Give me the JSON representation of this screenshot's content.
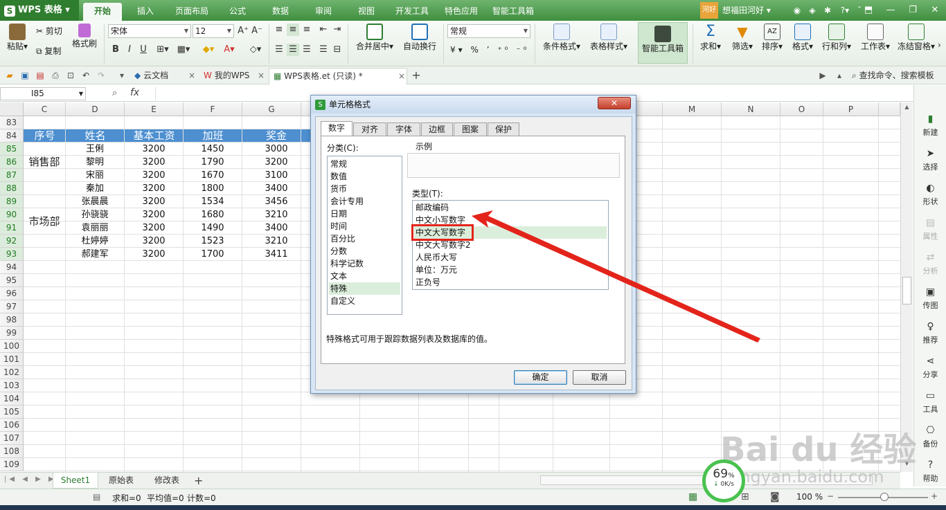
{
  "app": {
    "logo": "WPS 表格"
  },
  "menu": {
    "tabs": [
      "开始",
      "插入",
      "页面布局",
      "公式",
      "数据",
      "审阅",
      "视图",
      "开发工具",
      "特色应用",
      "智能工具箱"
    ],
    "active": "开始",
    "user_badge": "河好",
    "user_name": "想福田河好"
  },
  "ribbon": {
    "paste": "粘贴",
    "cut": "剪切",
    "copy": "复制",
    "format_painter": "格式刷",
    "font_name": "宋体",
    "font_size": "12",
    "bold": "B",
    "italic": "I",
    "underline": "U",
    "merge_center": "合并居中",
    "wrap_text": "自动换行",
    "number_format": "常规",
    "cond_format": "条件格式",
    "table_style": "表格样式",
    "smart_toolbox": "智能工具箱",
    "sum": "求和",
    "filter": "筛选",
    "sort": "排序",
    "format": "格式",
    "row_col": "行和列",
    "worksheet": "工作表",
    "freeze": "冻结窗格",
    "search": "查找命令、搜索模板"
  },
  "doc_tabs": [
    {
      "label": "云文档"
    },
    {
      "label": "我的WPS"
    },
    {
      "label": "WPS表格.et (只读) *"
    }
  ],
  "formula_bar": {
    "cell_ref": "I85",
    "fx": "fx"
  },
  "columns": [
    "C",
    "D",
    "E",
    "F",
    "G",
    "M",
    "N",
    "O",
    "P"
  ],
  "rows": [
    "83",
    "84",
    "85",
    "86",
    "87",
    "88",
    "89",
    "90",
    "91",
    "92",
    "93",
    "94",
    "95",
    "96",
    "97",
    "98",
    "99",
    "100",
    "101",
    "102",
    "103",
    "104",
    "105",
    "106",
    "107",
    "108",
    "109"
  ],
  "table": {
    "headers": [
      "序号",
      "姓名",
      "基本工资",
      "加班",
      "奖金"
    ],
    "groups": [
      {
        "name": "销售部"
      },
      {
        "name": "市场部"
      }
    ],
    "rows": [
      [
        "王俐",
        "3200",
        "1450",
        "3000"
      ],
      [
        "黎明",
        "3200",
        "1790",
        "3200"
      ],
      [
        "宋丽",
        "3200",
        "1670",
        "3100"
      ],
      [
        "秦加",
        "3200",
        "1800",
        "3400"
      ],
      [
        "张晨晨",
        "3200",
        "1534",
        "3456"
      ],
      [
        "孙骁骁",
        "3200",
        "1680",
        "3210"
      ],
      [
        "袁丽丽",
        "3200",
        "1490",
        "3400"
      ],
      [
        "杜婷婷",
        "3200",
        "1523",
        "3210"
      ],
      [
        "郝建军",
        "3200",
        "1700",
        "3411"
      ]
    ]
  },
  "right_panel": [
    "新建",
    "选择",
    "形状",
    "属性",
    "分析",
    "传图",
    "推荐",
    "分享",
    "工具",
    "备份",
    "帮助"
  ],
  "sheet_tabs": [
    "Sheet1",
    "原始表",
    "修改表"
  ],
  "status": {
    "sum": "求和=0",
    "avg": "平均值=0",
    "count": "计数=0",
    "zoom": "100 %"
  },
  "dialog": {
    "title": "单元格格式",
    "tabs": [
      "数字",
      "对齐",
      "字体",
      "边框",
      "图案",
      "保护"
    ],
    "category_label": "分类(C):",
    "categories": [
      "常规",
      "数值",
      "货币",
      "会计专用",
      "日期",
      "时间",
      "百分比",
      "分数",
      "科学记数",
      "文本",
      "特殊",
      "自定义"
    ],
    "selected_category": "特殊",
    "sample_label": "示例",
    "type_label": "类型(T):",
    "types": [
      "邮政编码",
      "中文小写数字",
      "中文大写数字",
      "中文大写数字2",
      "人民币大写",
      "单位：万元",
      "正负号"
    ],
    "selected_type": "中文大写数字",
    "description": "特殊格式可用于跟踪数据列表及数据库的值。",
    "ok": "确定",
    "cancel": "取消"
  },
  "watermark": {
    "main": "Bai du 经验",
    "sub": "jingyan.baidu.com"
  },
  "speed": {
    "percent": "69",
    "unit": "%",
    "rate": "0K/s"
  },
  "colors": {
    "accent": "#3f8f3f",
    "header_fill": "#4d8fd0",
    "highlight": "#e3241b"
  }
}
